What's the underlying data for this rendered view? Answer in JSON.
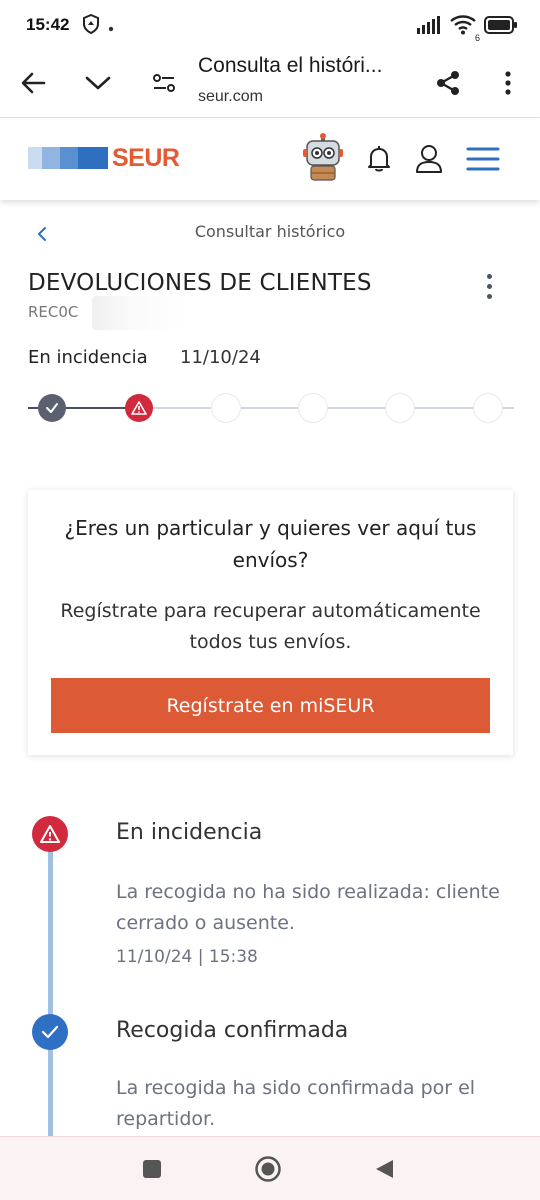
{
  "status_bar": {
    "time": "15:42",
    "wifi_badge": "6",
    "icons": [
      "shield-hand-icon",
      "dot-icon",
      "signal-icon",
      "wifi-icon",
      "battery-icon"
    ]
  },
  "browser": {
    "title": "Consulta el históri...",
    "domain": "seur.com",
    "icons": [
      "back-arrow-icon",
      "chevron-down-icon",
      "site-settings-icon",
      "share-icon",
      "more-vertical-icon"
    ]
  },
  "header": {
    "logo_text": "SEUR",
    "brand_color": "#e35a34",
    "icons": [
      "robot-assistant-icon",
      "bell-icon",
      "user-icon",
      "menu-icon"
    ]
  },
  "breadcrumb": {
    "label": "Consultar histórico"
  },
  "shipment": {
    "title": "DEVOLUCIONES DE CLIENTES",
    "reference_visible": "REC0C",
    "status_label": "En incidencia",
    "status_date": "11/10/24",
    "progress": {
      "steps_total": 6,
      "completed_step": 1,
      "current_step": 2,
      "current_state": "incident"
    }
  },
  "promo": {
    "question": "¿Eres un particular y quieres ver aquí tus envíos?",
    "subtitle": "Regístrate para recuperar automáticamente todos tus envíos.",
    "button_label": "Regístrate en miSEUR",
    "button_color": "#dc5a35"
  },
  "timeline": [
    {
      "title": "En incidencia",
      "description": "La recogida no ha sido realizada: cliente cerrado o ausente.",
      "timestamp": "11/10/24 | 15:38",
      "icon": "warning-icon",
      "color": "#d1293d"
    },
    {
      "title": "Recogida confirmada",
      "description": "La recogida ha sido confirmada por el repartidor.",
      "timestamp": "",
      "icon": "check-icon",
      "color": "#2f6fc4"
    }
  ],
  "nav_bar": {
    "icons": [
      "recents-icon",
      "home-icon",
      "back-icon"
    ]
  }
}
